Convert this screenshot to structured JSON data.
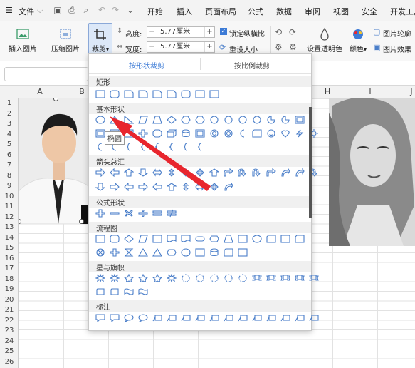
{
  "menubar": {
    "hamburger": "☰",
    "file": "文件",
    "items": [
      "开始",
      "插入",
      "页面布局",
      "公式",
      "数据",
      "审阅",
      "视图",
      "安全",
      "开发工具"
    ]
  },
  "ribbon": {
    "insert_picture": "插入图片",
    "compress_picture": "压缩图片",
    "crop": "裁剪",
    "height_label": "高度:",
    "height_value": "5.77厘米",
    "width_label": "宽度:",
    "width_value": "5.77厘米",
    "lock_ratio": "锁定纵横比",
    "reset_size": "重设大小",
    "set_transparent": "设置透明色",
    "color": "颜色",
    "picture_outline": "图片轮廓",
    "picture_effect": "图片效果"
  },
  "columns": [
    "A",
    "B",
    "H",
    "I",
    "J"
  ],
  "rows": [
    "1",
    "2",
    "3",
    "4",
    "5",
    "6",
    "7",
    "8",
    "9",
    "10",
    "11",
    "12",
    "13",
    "14",
    "15",
    "16",
    "17",
    "18",
    "19",
    "20",
    "21",
    "22",
    "23",
    "24",
    "25",
    "26"
  ],
  "dropdown": {
    "tab_shape": "按形状裁剪",
    "tab_ratio": "按比例裁剪",
    "sections": {
      "rect": "矩形",
      "basic": "基本形状",
      "arrows": "箭头总汇",
      "formula": "公式形状",
      "flowchart": "流程图",
      "stars": "星与旗帜",
      "callouts": "标注"
    },
    "tooltip": "椭圆"
  },
  "accent": "#3d7bd6",
  "arrow_color": "#e8262e"
}
